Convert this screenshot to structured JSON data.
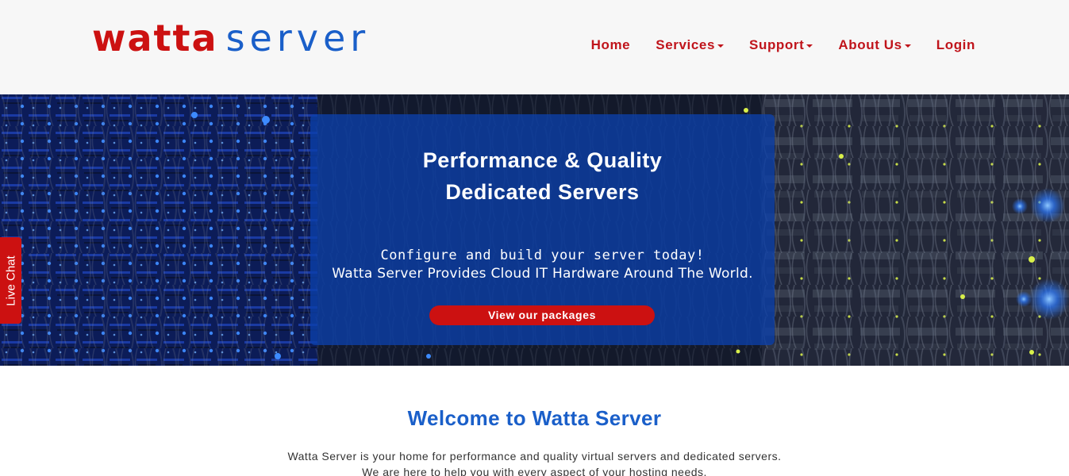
{
  "brand": {
    "part1": "watta",
    "part2": "server",
    "color_red": "#cc1111",
    "color_blue": "#1a5fc9"
  },
  "nav": {
    "items": [
      {
        "label": "Home",
        "dropdown": false
      },
      {
        "label": "Services",
        "dropdown": true
      },
      {
        "label": "Support",
        "dropdown": true
      },
      {
        "label": "About Us",
        "dropdown": true
      },
      {
        "label": "Login",
        "dropdown": false
      }
    ]
  },
  "hero": {
    "title_line1": "Performance & Quality",
    "title_line2": "Dedicated Servers",
    "subtitle": "Configure and build your server today!",
    "description": "Watta Server Provides Cloud IT Hardware Around The World.",
    "cta_label": "View our packages"
  },
  "live_chat": {
    "label": "Live Chat"
  },
  "welcome": {
    "title": "Welcome to Watta Server",
    "line1": "Watta Server is your home for performance and quality virtual servers and dedicated servers.",
    "line2": "We are here to help you with every aspect of your hosting needs."
  }
}
